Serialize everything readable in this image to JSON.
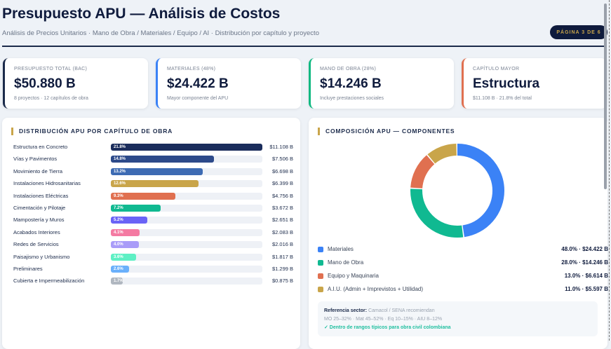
{
  "header": {
    "title": "Presupuesto APU — Análisis de Costos",
    "subtitle": "Análisis de Precios Unitarios · Mano de Obra / Materiales / Equipo / AI · Distribución por capítulo y proyecto",
    "page_badge": "PÁGINA 3 DE 6"
  },
  "kpis": [
    {
      "label": "PRESUPUESTO TOTAL (BAC)",
      "value": "$50.880 B",
      "sub": "8 proyectos · 12 capítulos de obra",
      "color": "#1b2a4a"
    },
    {
      "label": "MATERIALES (48%)",
      "value": "$24.422 B",
      "sub": "Mayor componente del APU",
      "color": "#3b82f6"
    },
    {
      "label": "MANO DE OBRA (28%)",
      "value": "$14.246 B",
      "sub": "Incluye prestaciones sociales",
      "color": "#10b981"
    },
    {
      "label": "CAPÍTULO MAYOR",
      "value": "Estructura",
      "sub": "$11.108 B · 21.8% del total",
      "color": "#e07050"
    }
  ],
  "chapters": {
    "title": "DISTRIBUCIÓN APU POR CAPÍTULO DE OBRA",
    "items": [
      {
        "name": "Estructura en Concreto",
        "pct": 21.8,
        "pct_label": "21.8%",
        "amount": "$11.108 B",
        "color": "#1b2d5c"
      },
      {
        "name": "Vías y Pavimentos",
        "pct": 14.8,
        "pct_label": "14.8%",
        "amount": "$7.506 B",
        "color": "#2d4a8a"
      },
      {
        "name": "Movimiento de Tierra",
        "pct": 13.2,
        "pct_label": "13.2%",
        "amount": "$6.698 B",
        "color": "#3d6bb3"
      },
      {
        "name": "Instalaciones Hidrosanitarias",
        "pct": 12.6,
        "pct_label": "12.6%",
        "amount": "$6.399 B",
        "color": "#c9a54a"
      },
      {
        "name": "Instalaciones Eléctricas",
        "pct": 9.3,
        "pct_label": "9.3%",
        "amount": "$4.756 B",
        "color": "#e07050"
      },
      {
        "name": "Cimentación y Pilotaje",
        "pct": 7.2,
        "pct_label": "7.2%",
        "amount": "$3.672 B",
        "color": "#10b991"
      },
      {
        "name": "Mampostería y Muros",
        "pct": 5.2,
        "pct_label": "5.2%",
        "amount": "$2.651 B",
        "color": "#6a63f6"
      },
      {
        "name": "Acabados Interiores",
        "pct": 4.1,
        "pct_label": "4.1%",
        "amount": "$2.083 B",
        "color": "#f47aa2"
      },
      {
        "name": "Redes de Servicios",
        "pct": 4.0,
        "pct_label": "4.0%",
        "amount": "$2.016 B",
        "color": "#a99cf8"
      },
      {
        "name": "Paisajismo y Urbanismo",
        "pct": 3.6,
        "pct_label": "3.6%",
        "amount": "$1.817 B",
        "color": "#5ef0c4"
      },
      {
        "name": "Preliminares",
        "pct": 2.6,
        "pct_label": "2.6%",
        "amount": "$1.299 B",
        "color": "#6ab0fb"
      },
      {
        "name": "Cubierta e Impermeabilización",
        "pct": 1.7,
        "pct_label": "1.7%",
        "amount": "$0.875 B",
        "color": "#b0b7c0"
      }
    ]
  },
  "composition": {
    "title": "COMPOSICIÓN APU — COMPONENTES",
    "items": [
      {
        "name": "Materiales",
        "pct": 48.0,
        "value": "48.0% · $24.422 B",
        "color": "#3b82f6"
      },
      {
        "name": "Mano de Obra",
        "pct": 28.0,
        "value": "28.0% · $14.246 B",
        "color": "#10b991"
      },
      {
        "name": "Equipo y Maquinaria",
        "pct": 13.0,
        "value": "13.0% · $6.614 B",
        "color": "#e07050"
      },
      {
        "name": "A.I.U. (Admin + Imprevistos + Utilidad)",
        "pct": 11.0,
        "value": "11.0% · $5.597 B",
        "color": "#c9a54a"
      }
    ],
    "reference": {
      "label": "Referencia sector:",
      "source": "Camacol / SENA recomiendan",
      "ranges": "MO 25–32% · Mat 45–52% · Eq 10–15% · AIU 8–12%",
      "status": "✓ Dentro de rangos típicos para obra civil colombiana"
    }
  }
}
